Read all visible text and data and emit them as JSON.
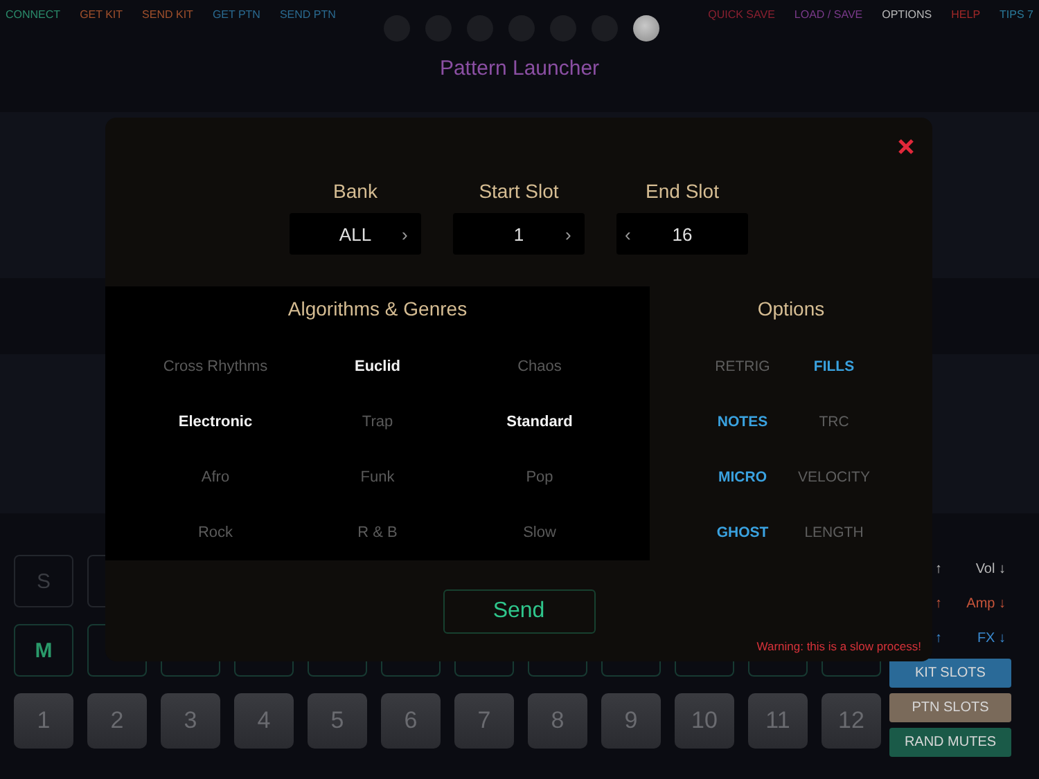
{
  "top_bar": {
    "left": [
      {
        "label": "CONNECT",
        "color": "#2a8a6a"
      },
      {
        "label": "GET KIT",
        "color": "#a0502c"
      },
      {
        "label": "SEND KIT",
        "color": "#a0502c"
      },
      {
        "label": "GET PTN",
        "color": "#2a6a90"
      },
      {
        "label": "SEND PTN",
        "color": "#2a6a90"
      }
    ],
    "pages": [
      {
        "selected": false
      },
      {
        "selected": false
      },
      {
        "selected": false
      },
      {
        "selected": false
      },
      {
        "selected": false
      },
      {
        "selected": false
      },
      {
        "selected": true
      }
    ],
    "right": [
      {
        "label": "QUICK SAVE",
        "color": "#8a2030"
      },
      {
        "label": "LOAD / SAVE",
        "color": "#7a3a8a"
      },
      {
        "label": "OPTIONS",
        "color": "#b8b8b8"
      },
      {
        "label": "HELP",
        "color": "#a02828"
      },
      {
        "label": "TIPS 7",
        "color": "#2a7a9a"
      }
    ]
  },
  "title": "Pattern Launcher",
  "pads": {
    "row_1_label": "S",
    "row_2_label": "M",
    "numbers": [
      "1",
      "2",
      "3",
      "4",
      "5",
      "6",
      "7",
      "8",
      "9",
      "10",
      "11",
      "12"
    ]
  },
  "side": {
    "controls": [
      {
        "up": "↑",
        "down": "Vol ↓",
        "color": "#b8b8b8"
      },
      {
        "up": "↑",
        "down": "Amp ↓",
        "color": "#c8553a"
      },
      {
        "up": "↑",
        "down": "FX ↓",
        "color": "#3a8ad0"
      }
    ],
    "buttons": [
      {
        "label": "KIT SLOTS",
        "color": "#2a6a98"
      },
      {
        "label": "PTN SLOTS",
        "color": "#7a6a5a"
      },
      {
        "label": "RAND MUTES",
        "color": "#1a5a48"
      }
    ]
  },
  "dialog": {
    "selectors": [
      {
        "label": "Bank",
        "value": "ALL",
        "next": "›"
      },
      {
        "label": "Start Slot",
        "value": "1",
        "next": "›"
      },
      {
        "label": "End Slot",
        "value": "16",
        "prev": "‹"
      }
    ],
    "genres_title": "Algorithms & Genres",
    "genres": [
      {
        "label": "Cross Rhythms",
        "selected": false
      },
      {
        "label": "Euclid",
        "selected": true
      },
      {
        "label": "Chaos",
        "selected": false
      },
      {
        "label": "Electronic",
        "selected": true
      },
      {
        "label": "Trap",
        "selected": false
      },
      {
        "label": "Standard",
        "selected": true
      },
      {
        "label": "Afro",
        "selected": false
      },
      {
        "label": "Funk",
        "selected": false
      },
      {
        "label": "Pop",
        "selected": false
      },
      {
        "label": "Rock",
        "selected": false
      },
      {
        "label": "R & B",
        "selected": false
      },
      {
        "label": "Slow",
        "selected": false
      }
    ],
    "options_title": "Options",
    "options": [
      {
        "label": "RETRIG",
        "selected": false
      },
      {
        "label": "FILLS",
        "selected": true
      },
      {
        "label": "NOTES",
        "selected": true
      },
      {
        "label": "TRC",
        "selected": false
      },
      {
        "label": "MICRO",
        "selected": true
      },
      {
        "label": "VELOCITY",
        "selected": false
      },
      {
        "label": "GHOST",
        "selected": true
      },
      {
        "label": "LENGTH",
        "selected": false
      }
    ],
    "send": "Send",
    "warning": "Warning: this is a slow process!"
  }
}
